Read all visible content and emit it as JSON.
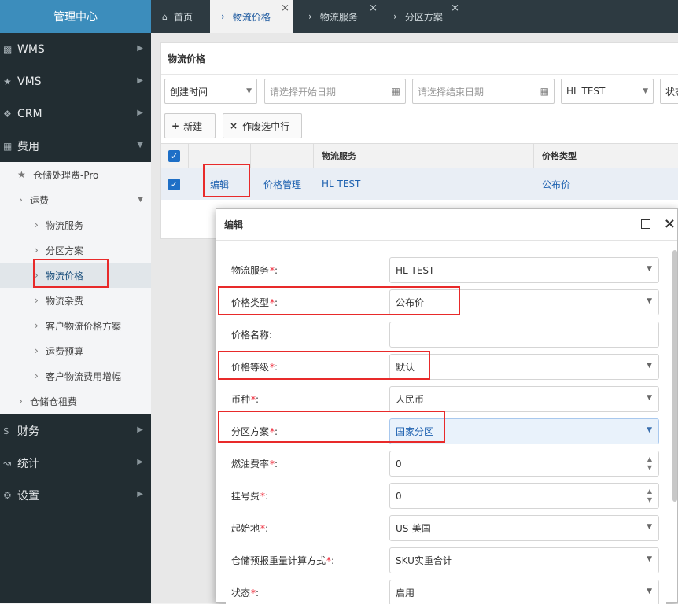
{
  "sidebar": {
    "title": "管理中心",
    "top_items": [
      {
        "label": "WMS",
        "icon": "bank-icon"
      },
      {
        "label": "VMS",
        "icon": "star-icon"
      },
      {
        "label": "CRM",
        "icon": "info-icon"
      },
      {
        "label": "费用",
        "icon": "table-icon"
      }
    ],
    "fee_sub": {
      "warehouse_fee": "仓储处理费-Pro",
      "freight": "运费",
      "freight_items": [
        "物流服务",
        "分区方案",
        "物流价格",
        "物流杂费",
        "客户物流价格方案",
        "运费预算",
        "客户物流费用增幅"
      ],
      "storage_rent": "仓储仓租费"
    },
    "bottom_items": [
      {
        "label": "财务",
        "icon": "dollar-icon"
      },
      {
        "label": "统计",
        "icon": "chart-icon"
      },
      {
        "label": "设置",
        "icon": "gear-icon"
      }
    ]
  },
  "tabs": {
    "home": "首页",
    "items": [
      "物流价格",
      "物流服务",
      "分区方案"
    ]
  },
  "panel": {
    "title": "物流价格",
    "filters": {
      "time_field": "创建时间",
      "start_placeholder": "请选择开始日期",
      "end_placeholder": "请选择结束日期",
      "service": "HL TEST",
      "status_partial": "状态"
    },
    "buttons": {
      "new": "新建",
      "void": "作废选中行"
    },
    "grid": {
      "headers": [
        "物流服务",
        "价格类型"
      ],
      "row": {
        "edit": "编辑",
        "manage": "价格管理",
        "service": "HL TEST",
        "price_type": "公布价"
      }
    }
  },
  "dialog": {
    "title": "编辑",
    "fields": [
      {
        "label": "物流服务",
        "required": true,
        "value": "HL TEST",
        "type": "select"
      },
      {
        "label": "价格类型",
        "required": true,
        "value": "公布价",
        "type": "select"
      },
      {
        "label": "价格名称",
        "required": false,
        "value": "",
        "type": "text"
      },
      {
        "label": "价格等级",
        "required": true,
        "value": "默认",
        "type": "select"
      },
      {
        "label": "币种",
        "required": true,
        "value": "人民币",
        "type": "select"
      },
      {
        "label": "分区方案",
        "required": true,
        "value": "国家分区",
        "type": "select"
      },
      {
        "label": "燃油费率",
        "required": true,
        "value": "0",
        "type": "number"
      },
      {
        "label": "挂号费 ",
        "required": true,
        "value": "0",
        "type": "number"
      },
      {
        "label": "起始地 ",
        "required": true,
        "value": "US-美国",
        "type": "select"
      },
      {
        "label": "仓储预报重量计算方式",
        "required": true,
        "value": "SKU实重合计",
        "type": "select"
      },
      {
        "label": "状态",
        "required": true,
        "value": "启用",
        "type": "select"
      }
    ]
  },
  "colors": {
    "sidebar_bg": "#222d32",
    "header_blue": "#3c8dbc",
    "accent": "#1e6fc6",
    "highlight_red": "#e82a2a",
    "required": "#e23"
  }
}
